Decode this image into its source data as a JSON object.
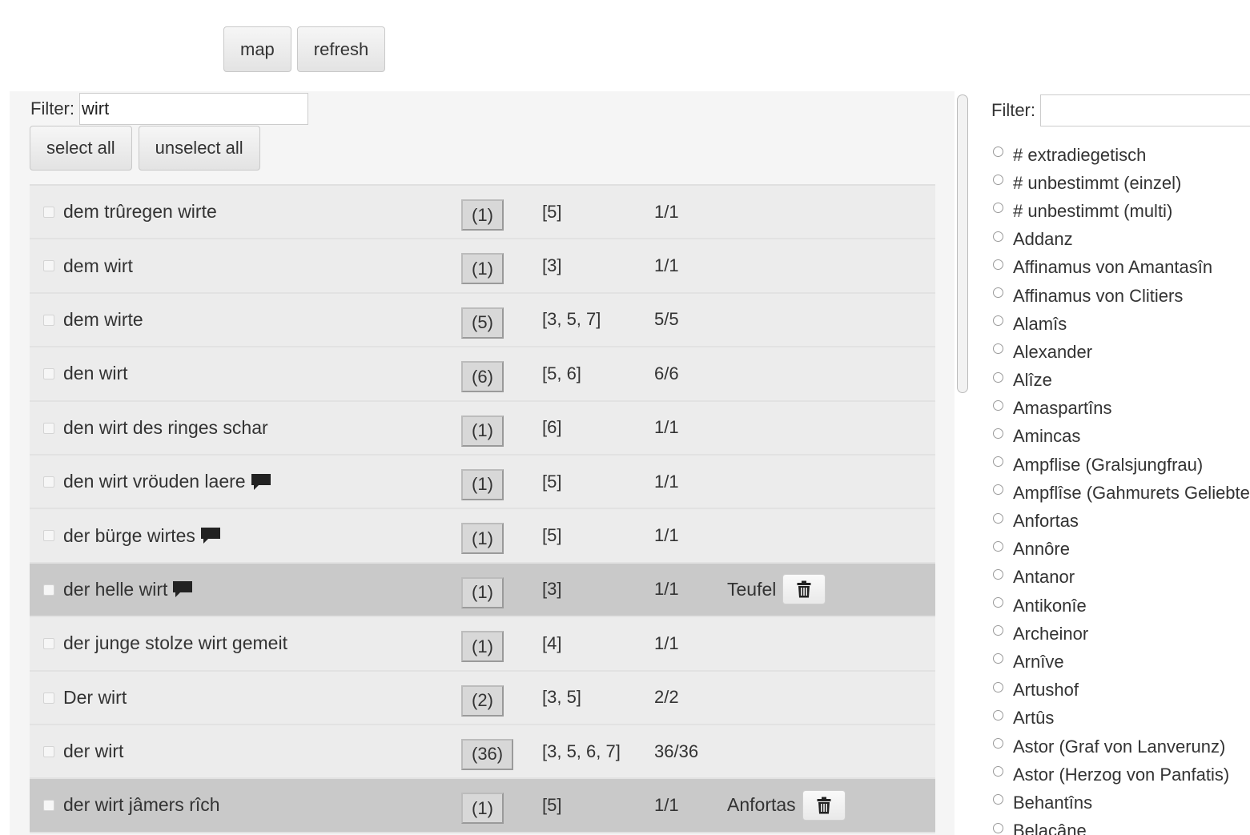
{
  "toolbar": {
    "map_label": "map",
    "refresh_label": "refresh"
  },
  "left": {
    "filter_label": "Filter:",
    "filter_value": "wirt",
    "select_all_label": "select all",
    "unselect_all_label": "unselect all",
    "rows": [
      {
        "label": "dem trûregen wirte",
        "comment": false,
        "count": "(1)",
        "pages": "[5]",
        "ratio": "1/1",
        "selected": false,
        "assigned": ""
      },
      {
        "label": "dem wirt",
        "comment": false,
        "count": "(1)",
        "pages": "[3]",
        "ratio": "1/1",
        "selected": false,
        "assigned": ""
      },
      {
        "label": "dem wirte",
        "comment": false,
        "count": "(5)",
        "pages": "[3, 5, 7]",
        "ratio": "5/5",
        "selected": false,
        "assigned": ""
      },
      {
        "label": "den wirt",
        "comment": false,
        "count": "(6)",
        "pages": "[5, 6]",
        "ratio": "6/6",
        "selected": false,
        "assigned": ""
      },
      {
        "label": "den wirt des ringes schar",
        "comment": false,
        "count": "(1)",
        "pages": "[6]",
        "ratio": "1/1",
        "selected": false,
        "assigned": ""
      },
      {
        "label": "den wirt vröuden laere",
        "comment": true,
        "count": "(1)",
        "pages": "[5]",
        "ratio": "1/1",
        "selected": false,
        "assigned": ""
      },
      {
        "label": "der bürge wirtes",
        "comment": true,
        "count": "(1)",
        "pages": "[5]",
        "ratio": "1/1",
        "selected": false,
        "assigned": ""
      },
      {
        "label": "der helle wirt",
        "comment": true,
        "count": "(1)",
        "pages": "[3]",
        "ratio": "1/1",
        "selected": true,
        "assigned": "Teufel"
      },
      {
        "label": "der junge stolze wirt gemeit",
        "comment": false,
        "count": "(1)",
        "pages": "[4]",
        "ratio": "1/1",
        "selected": false,
        "assigned": ""
      },
      {
        "label": "Der wirt",
        "comment": false,
        "count": "(2)",
        "pages": "[3, 5]",
        "ratio": "2/2",
        "selected": false,
        "assigned": ""
      },
      {
        "label": "der wirt",
        "comment": false,
        "count": "(36)",
        "pages": "[3, 5, 6, 7]",
        "ratio": "36/36",
        "selected": false,
        "assigned": ""
      },
      {
        "label": "der wirt jâmers rîch",
        "comment": false,
        "count": "(1)",
        "pages": "[5]",
        "ratio": "1/1",
        "selected": true,
        "assigned": "Anfortas"
      }
    ]
  },
  "right": {
    "filter_label": "Filter:",
    "filter_value": "",
    "names": [
      "# extradiegetisch",
      "# unbestimmt (einzel)",
      "# unbestimmt (multi)",
      "Addanz",
      "Affinamus von Amantasîn",
      "Affinamus von Clitiers",
      "Alamîs",
      "Alexander",
      "Alîze",
      "Amaspartîns",
      "Amincas",
      "Ampflise (Gralsjungfrau)",
      "Ampflîse (Gahmurets Geliebte)",
      "Anfortas",
      "Annôre",
      "Antanor",
      "Antikonîe",
      "Archeinor",
      "Arnîve",
      "Artushof",
      "Artûs",
      "Astor (Graf von Lanverunz)",
      "Astor (Herzog von Panfatis)",
      "Behantîns",
      "Belacâne"
    ]
  },
  "icons": {
    "comment": "comment-icon",
    "trash": "trash-icon",
    "radio": "radio-icon"
  }
}
